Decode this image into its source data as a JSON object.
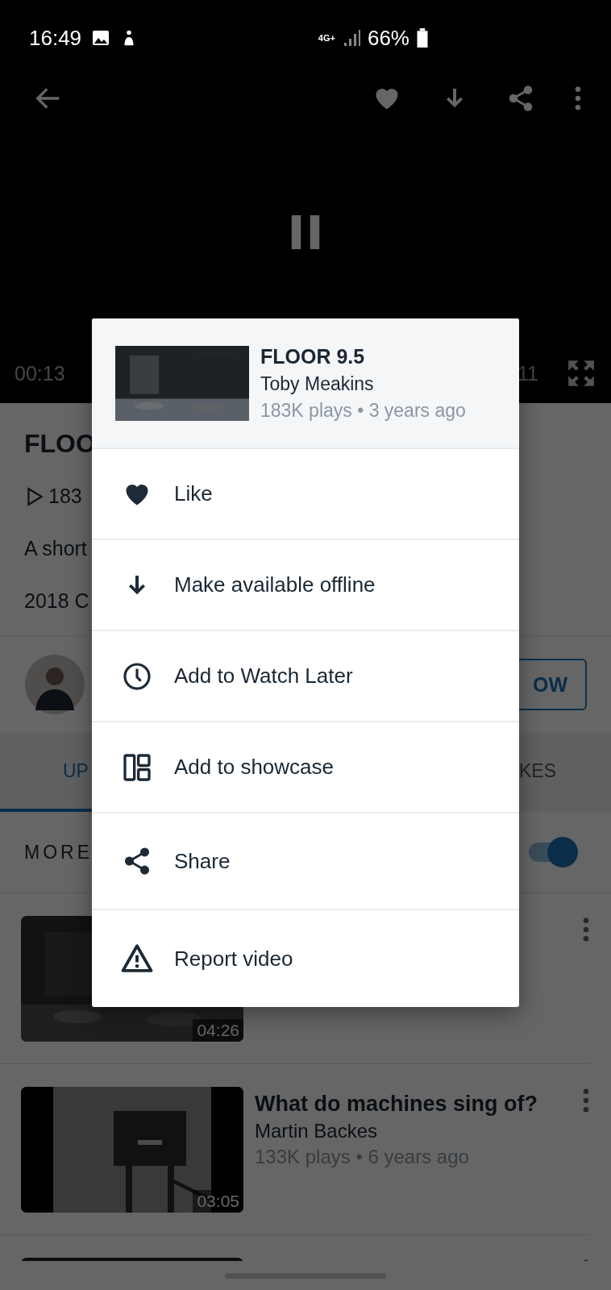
{
  "status_bar": {
    "time": "16:49",
    "network": "4G+",
    "battery": "66%"
  },
  "player": {
    "current_time": "00:13",
    "duration": "11"
  },
  "video_info": {
    "title": "FLOO",
    "plays": "183",
    "description": "A short",
    "credit": "2018 C"
  },
  "creator": {
    "follow_button": "OW"
  },
  "tabs": [
    {
      "label": "UP",
      "selected": true
    },
    {
      "label": "KES",
      "selected": false
    }
  ],
  "more": {
    "label": "MORE",
    "autoplay": {
      "on": true
    }
  },
  "videos": [
    {
      "kind": "video",
      "duration": "04:26"
    },
    {
      "kind": "video",
      "title": "What do machines sing of?",
      "author": "Martin Backes",
      "meta": "133K plays • 6 years ago",
      "duration": "03:05"
    },
    {
      "kind": "video"
    }
  ],
  "menu": {
    "header": {
      "title": "FLOOR 9.5",
      "author": "Toby Meakins",
      "meta": "183K plays • 3 years ago"
    },
    "items": [
      {
        "kind": "like",
        "label": "Like"
      },
      {
        "kind": "offline",
        "label": "Make available offline"
      },
      {
        "kind": "watch_later",
        "label": "Add to Watch Later"
      },
      {
        "kind": "showcase",
        "label": "Add to showcase"
      },
      {
        "kind": "share",
        "label": "Share"
      },
      {
        "kind": "report",
        "label": "Report video"
      }
    ]
  }
}
